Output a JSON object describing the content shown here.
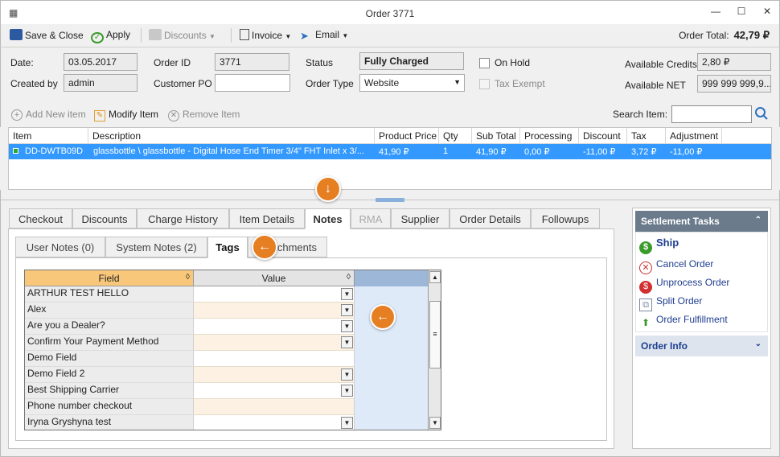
{
  "window": {
    "title": "Order 3771"
  },
  "toolbar": {
    "save_close": "Save & Close",
    "apply": "Apply",
    "discounts": "Discounts",
    "invoice": "Invoice",
    "email": "Email",
    "order_total_label": "Order Total:",
    "order_total_value": "42,79 ₽"
  },
  "form": {
    "date_label": "Date:",
    "date_value": "03.05.2017",
    "created_by_label": "Created by",
    "created_by_value": "admin",
    "order_id_label": "Order ID",
    "order_id_value": "3771",
    "customer_po_label": "Customer PO",
    "customer_po_value": "",
    "status_label": "Status",
    "status_value": "Fully Charged",
    "order_type_label": "Order Type",
    "order_type_value": "Website",
    "on_hold_label": "On Hold",
    "tax_exempt_label": "Tax Exempt",
    "available_credits_label": "Available Credits",
    "available_credits_value": "2,80 ₽",
    "available_net_label": "Available NET",
    "available_net_value": "999 999 999,9..."
  },
  "items_toolbar": {
    "add_new_item": "Add New item",
    "modify_item": "Modify Item",
    "remove_item": "Remove Item",
    "search_item_label": "Search Item:",
    "search_item_value": ""
  },
  "item_grid": {
    "columns": [
      "Item",
      "Description",
      "Product Price",
      "Qty",
      "Sub Total",
      "Processing",
      "Discount",
      "Tax",
      "Adjustment"
    ],
    "rows": [
      [
        "DD-DWTB09D",
        "glassbottle \\ glassbottle - Digital Hose End Timer 3/4\" FHT Inlet x 3/...",
        "41,90 ₽",
        "1",
        "41,90 ₽",
        "0,00 ₽",
        "-11,00 ₽",
        "3,72 ₽",
        "-11,00 ₽"
      ]
    ]
  },
  "tabs": [
    "Checkout",
    "Discounts",
    "Charge History",
    "Item Details",
    "Notes",
    "RMA",
    "Supplier",
    "Order Details",
    "Followups"
  ],
  "subtabs": [
    "User Notes (0)",
    "System Notes (2)",
    "Tags",
    "Attachments"
  ],
  "tags_grid": {
    "field_header": "Field",
    "value_header": "Value",
    "rows": [
      {
        "field": "ARTHUR TEST HELLO",
        "dropdown": true
      },
      {
        "field": "Alex",
        "dropdown": true
      },
      {
        "field": "Are you a Dealer?",
        "dropdown": true
      },
      {
        "field": "Confirm Your Payment Method",
        "dropdown": true
      },
      {
        "field": "Demo Field",
        "dropdown": false
      },
      {
        "field": "Demo Field 2",
        "dropdown": true
      },
      {
        "field": "Best Shipping Carrier",
        "dropdown": true
      },
      {
        "field": "Phone number checkout",
        "dropdown": false
      },
      {
        "field": "Iryna Gryshyna test",
        "dropdown": true
      }
    ]
  },
  "settlement": {
    "title": "Settlement Tasks",
    "ship": "Ship",
    "cancel_order": "Cancel Order",
    "unprocess_order": "Unprocess Order",
    "split_order": "Split Order",
    "order_fulfillment": "Order Fulfillment",
    "order_info": "Order Info"
  },
  "colors": {
    "selection": "#3399ff",
    "hint_orange": "#e67e22",
    "panel_header": "#6b7b8c",
    "link": "#1e3d8f"
  }
}
